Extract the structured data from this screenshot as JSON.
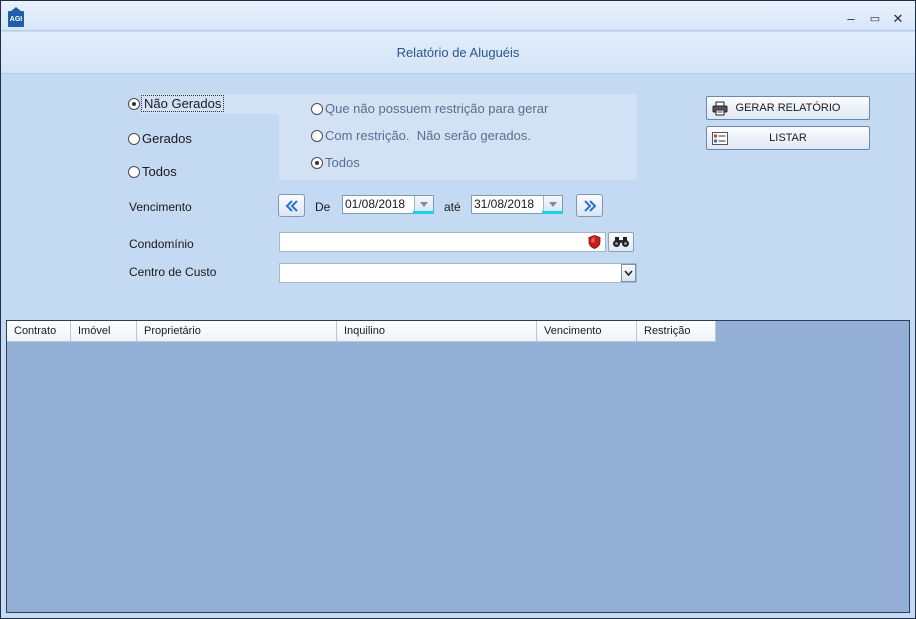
{
  "window": {
    "app_icon_text": "AGI",
    "minimize": "–",
    "maximize": "▭",
    "close": "✕"
  },
  "header": {
    "title": "Relatório de Aluguéis"
  },
  "status_filter": {
    "options": [
      {
        "label": "Não Gerados",
        "selected": true
      },
      {
        "label": "Gerados",
        "selected": false
      },
      {
        "label": "Todos",
        "selected": false
      }
    ]
  },
  "restriction_filter": {
    "options": [
      {
        "label": "Que não possuem restrição para gerar",
        "selected": false
      },
      {
        "label": "Com restrição.  Não serão gerados.",
        "selected": false
      },
      {
        "label": "Todos",
        "selected": true
      }
    ]
  },
  "actions": {
    "generate_label": "GERAR RELATÓRIO",
    "list_label": "LISTAR"
  },
  "vencimento": {
    "label": "Vencimento",
    "from_label": "De",
    "from_value": "01/08/2018",
    "to_label": "até",
    "to_value": "31/08/2018"
  },
  "condominio": {
    "label": "Condomínio",
    "value": ""
  },
  "centro_custo": {
    "label": "Centro de Custo",
    "value": ""
  },
  "table": {
    "columns": [
      "Contrato",
      "Imóvel",
      "Proprietário",
      "Inquilino",
      "Vencimento",
      "Restrição"
    ],
    "rows": []
  },
  "colors": {
    "background": "#c4d9f2",
    "grid_background": "#93afd6",
    "title_text": "#2c568f",
    "date_accent": "#17d4e8"
  }
}
